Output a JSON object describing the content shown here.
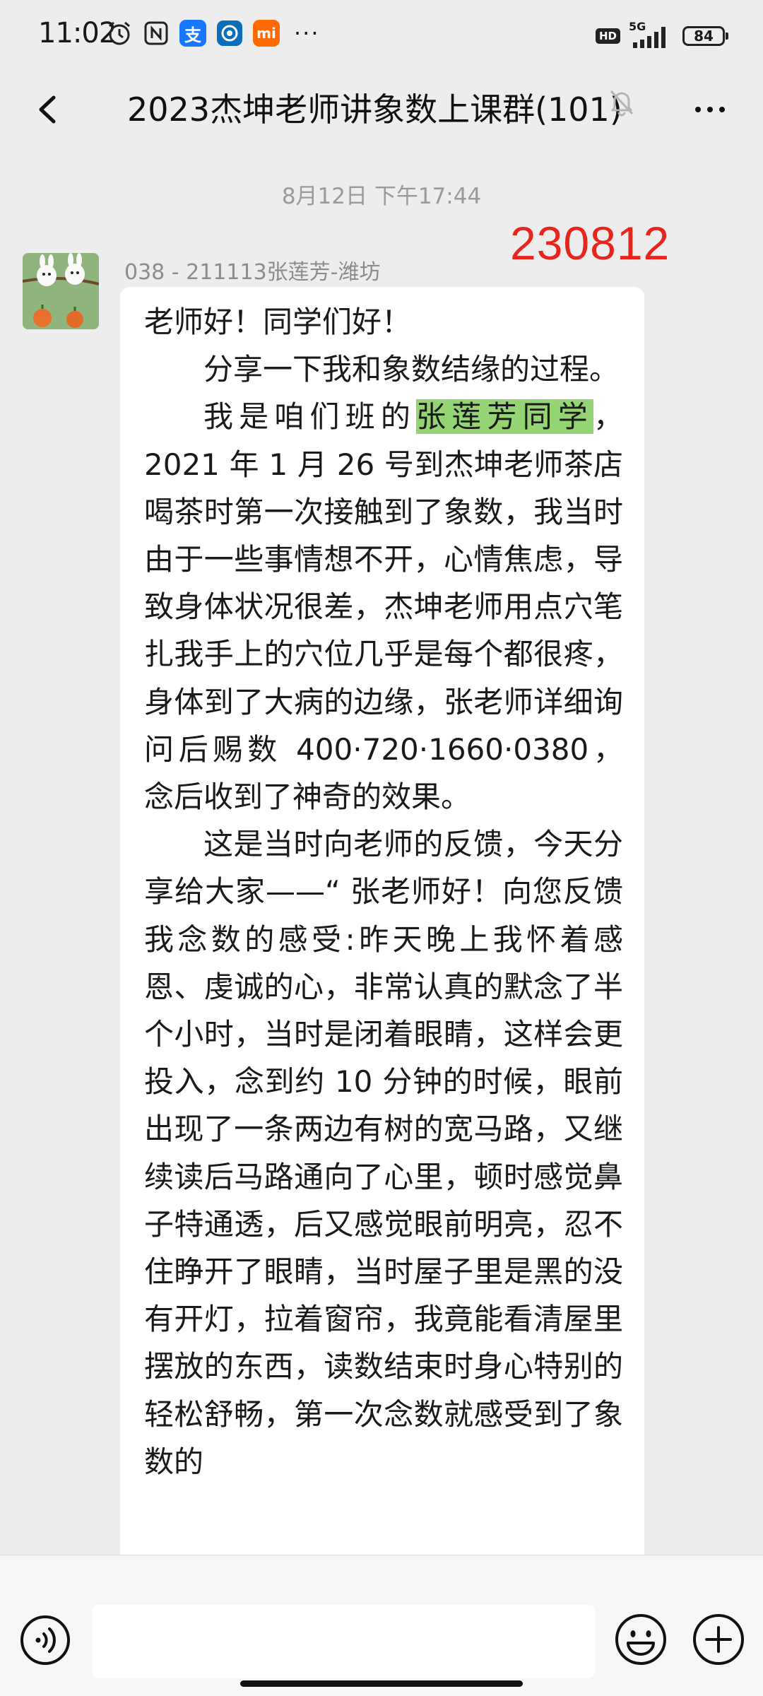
{
  "status_bar": {
    "time": "11:02",
    "network": "5G",
    "hd_label": "HD",
    "battery": "84",
    "left_icons": [
      "alarm-clock-icon",
      "nfc-icon",
      "alipay-icon",
      "bank-app-icon",
      "mi-icon"
    ],
    "alipay_glyph": "支",
    "mi_glyph": "mi",
    "more": "···"
  },
  "nav": {
    "title": "2023杰坤老师讲象数上课群(101)",
    "icons": [
      "back-arrow-icon",
      "muted-bell-icon",
      "more-icon"
    ]
  },
  "chat": {
    "timestamp": "8月12日 下午17:44",
    "watermark": "230812",
    "message": {
      "sender": "038 - 211113张莲芳-潍坊",
      "greeting": "老师好！同学们好！",
      "para1": "分享一下我和象数结缘的过程。",
      "para2_pre": "我是咱们班的",
      "para2_highlight": "张莲芳同学",
      "para2_post": "，2021 年 1 月 26 号到杰坤老师茶店喝茶时第一次接触到了象数，我当时由于一些事情想不开，心情焦虑，导致身体状况很差，杰坤老师用点穴笔扎我手上的穴位几乎是每个都很疼，身体到了大病的边缘，张老师详细询问后赐数 400·720·1660·0380，念后收到了神奇的效果。",
      "para3": "这是当时向老师的反馈，今天分享给大家——“ 张老师好！向您反馈我念数的感受:昨天晚上我怀着感恩、虔诚的心，非常认真的默念了半个小时，当时是闭着眼睛，这样会更投入，念到约 10 分钟的时候，眼前出现了一条两边有树的宽马路，又继续读后马路通向了心里，顿时感觉鼻子特通透，后又感觉眼前明亮，忍不住睁开了眼睛，当时屋子里是黑的没有开灯，拉着窗帘，我竟能看清屋里摆放的东西，读数结束时身心特别的轻松舒畅，第一次念数就感受到了象数的"
    }
  },
  "bottom_bar": {
    "input_value": "",
    "icons": [
      "voice-icon",
      "emoji-icon",
      "plus-icon"
    ]
  },
  "colors": {
    "background": "#ededed",
    "bubble": "#ffffff",
    "highlight": "#95d475",
    "watermark": "#e8251c",
    "meta_text": "#9a9a9a"
  }
}
